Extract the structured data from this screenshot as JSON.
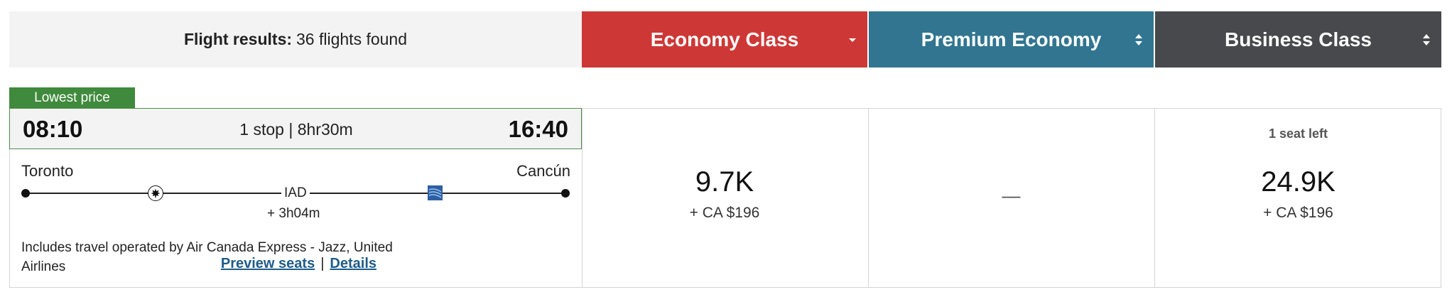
{
  "header": {
    "results_label": "Flight results:",
    "results_count": "36 flights found",
    "cabins": [
      {
        "label": "Economy Class",
        "color": "#cd3836",
        "sort_icon": "caret-down-icon"
      },
      {
        "label": "Premium Economy",
        "color": "#317590",
        "sort_icon": "sort-updown-icon"
      },
      {
        "label": "Business Class",
        "color": "#48494c",
        "sort_icon": "sort-updown-icon"
      }
    ]
  },
  "flight": {
    "badge": "Lowest price",
    "depart_time": "08:10",
    "arrive_time": "16:40",
    "summary": "1 stop | 8hr30m",
    "origin": "Toronto",
    "destination": "Cancún",
    "connection_airport": "IAD",
    "layover": "+ 3h04m",
    "carrier_icons": [
      "air-canada-icon",
      "united-airlines-icon"
    ],
    "operated_by": "Includes travel operated by Air Canada Express - Jazz, United Airlines",
    "preview_seats_label": "Preview seats",
    "separator": "|",
    "details_label": "Details"
  },
  "fares": {
    "economy": {
      "points": "9.7K",
      "taxes": "+ CA $196"
    },
    "premium": {
      "unavailable": "—"
    },
    "business": {
      "seats_left": "1 seat left",
      "points": "24.9K",
      "taxes": "+ CA $196"
    }
  },
  "colors": {
    "badge_green": "#3f8a3c",
    "link_blue": "#1f5c8a",
    "border": "#d4d4d4"
  }
}
